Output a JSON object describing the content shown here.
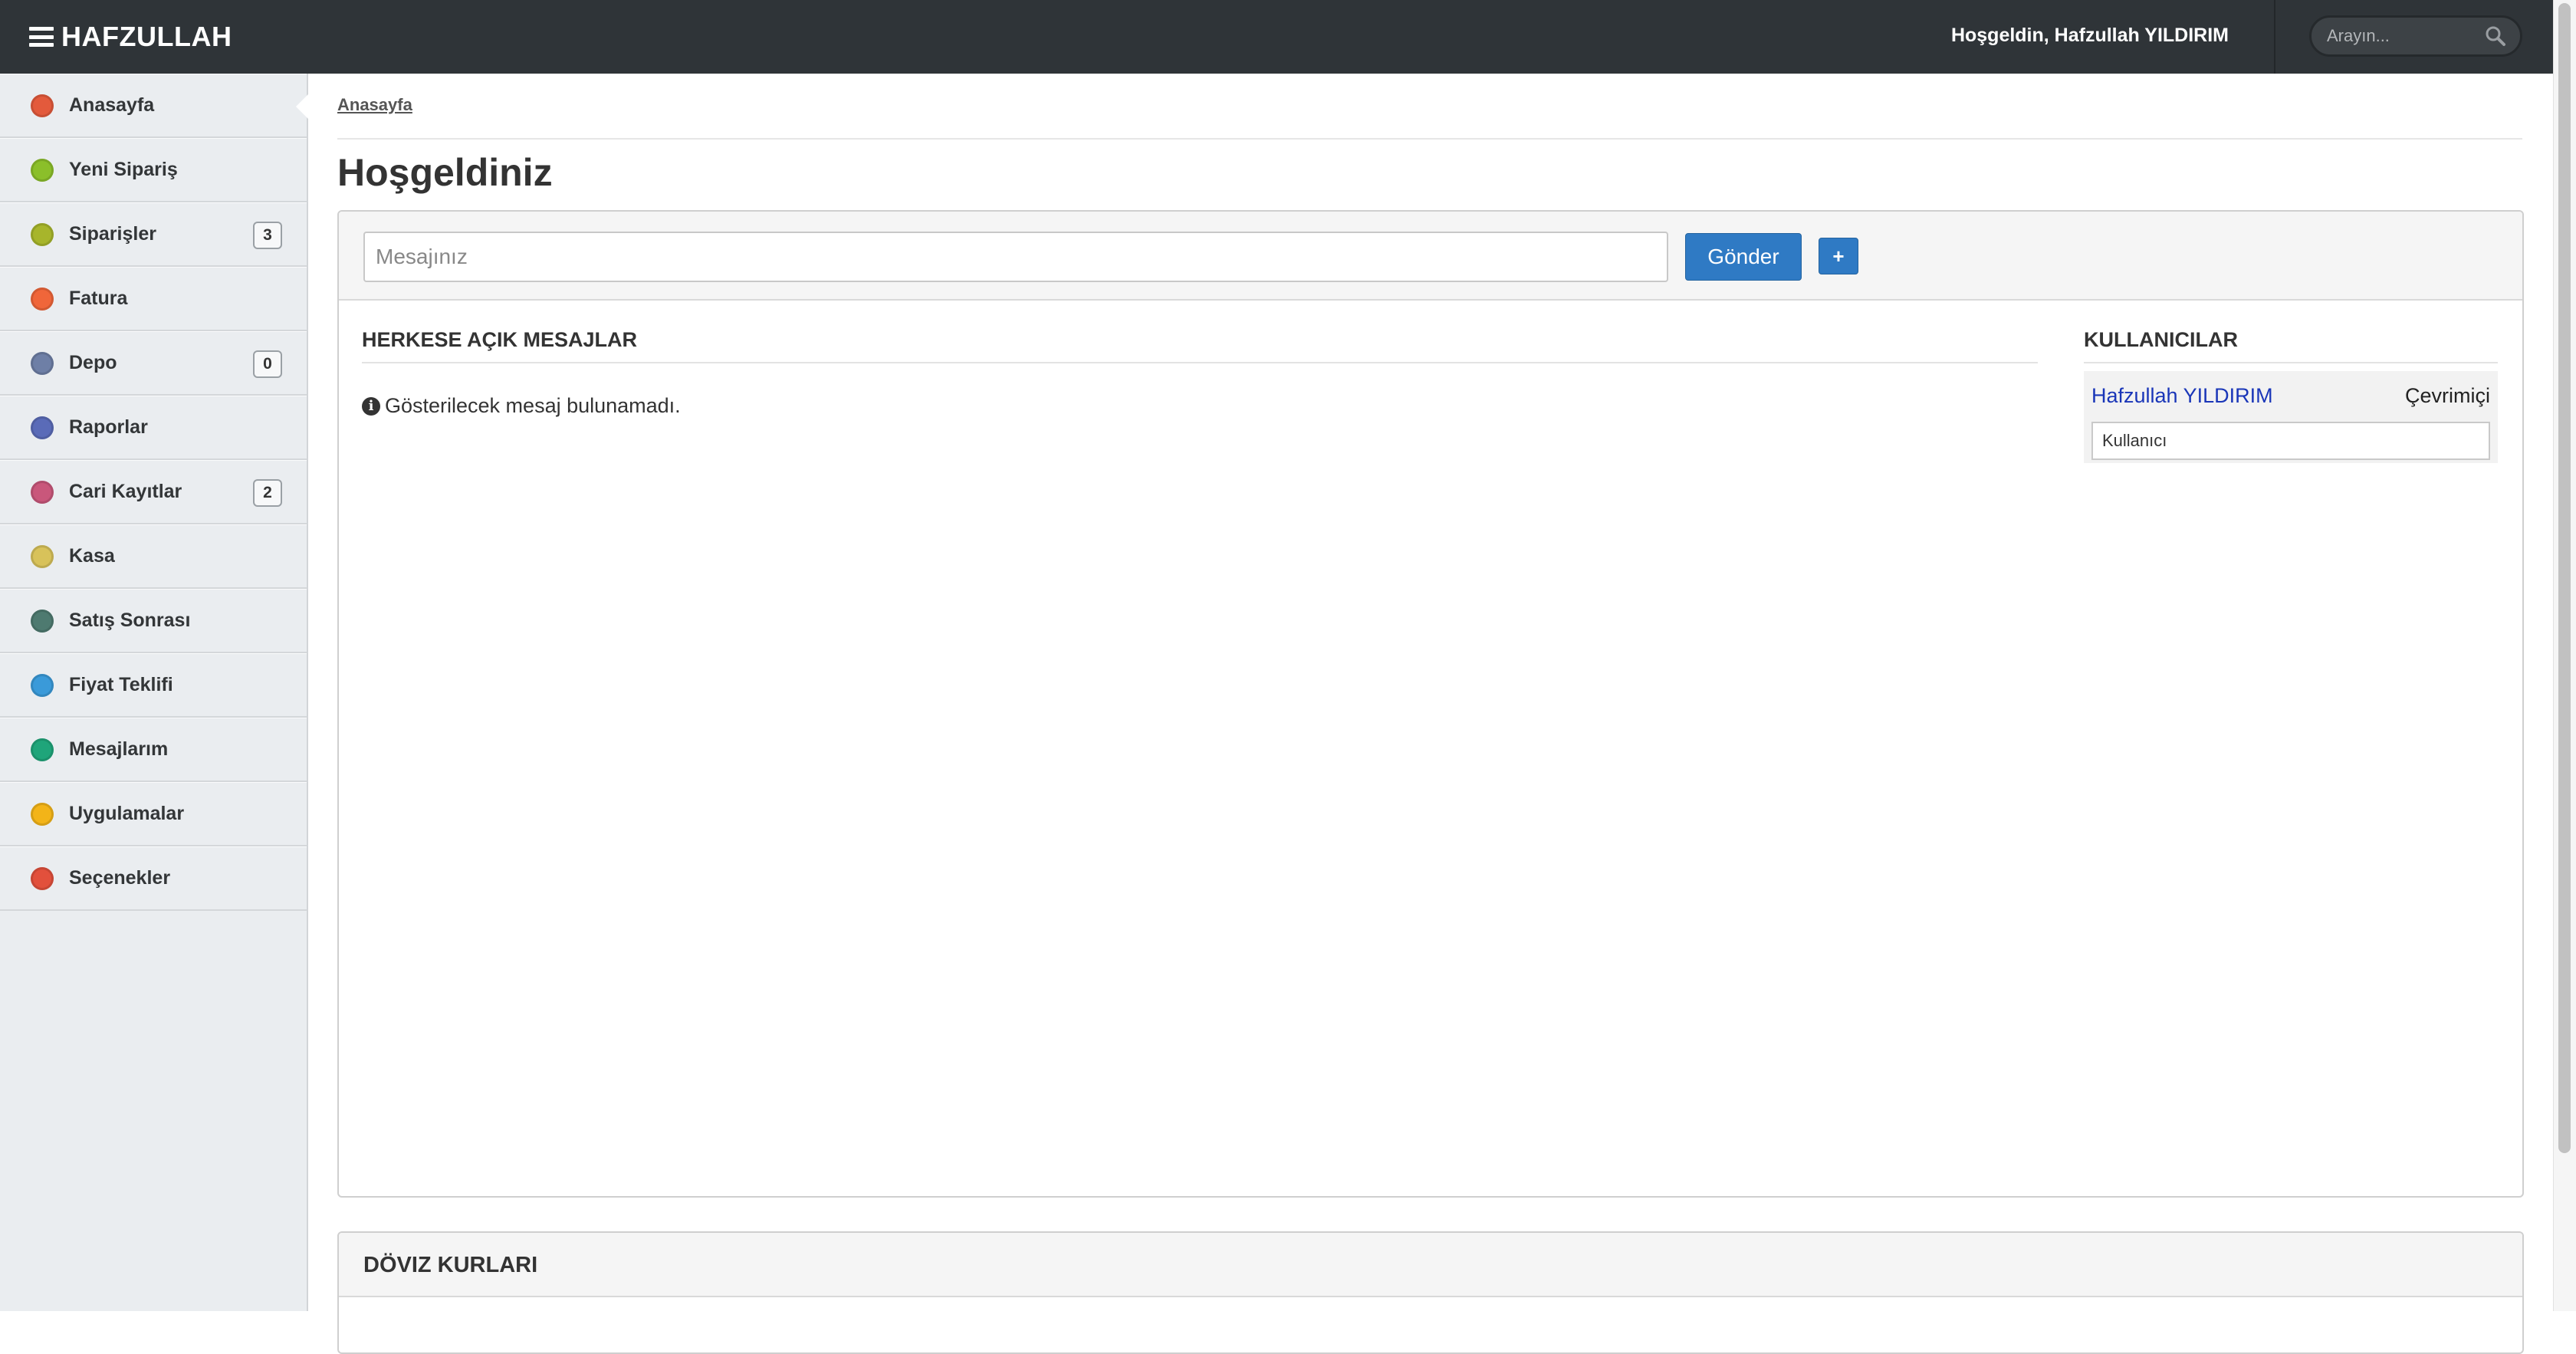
{
  "header": {
    "brand": "HAFZULLAH",
    "welcome": "Hoşgeldin, Hafzullah YILDIRIM",
    "search_placeholder": "Arayın..."
  },
  "sidebar": {
    "items": [
      {
        "label": "Anasayfa",
        "icon": "home-icon",
        "color": "#e35a3c",
        "active": true
      },
      {
        "label": "Yeni Sipariş",
        "icon": "new-order-icon",
        "color": "#8bbf2a"
      },
      {
        "label": "Siparişler",
        "icon": "orders-icon",
        "color": "#a7b52b",
        "badge": "3"
      },
      {
        "label": "Fatura",
        "icon": "invoice-icon",
        "color": "#f0663a"
      },
      {
        "label": "Depo",
        "icon": "warehouse-icon",
        "color": "#6e7fa6",
        "badge": "0"
      },
      {
        "label": "Raporlar",
        "icon": "reports-icon",
        "color": "#5a6bb8"
      },
      {
        "label": "Cari Kayıtlar",
        "icon": "accounts-icon",
        "color": "#c9577b",
        "badge": "2"
      },
      {
        "label": "Kasa",
        "icon": "cashbox-icon",
        "color": "#d8c25a"
      },
      {
        "label": "Satış Sonrası",
        "icon": "after-sales-icon",
        "color": "#4e7a70"
      },
      {
        "label": "Fiyat Teklifi",
        "icon": "price-offer-icon",
        "color": "#3a9ad9"
      },
      {
        "label": "Mesajlarım",
        "icon": "messages-icon",
        "color": "#1fa57a"
      },
      {
        "label": "Uygulamalar",
        "icon": "apps-icon",
        "color": "#f3b418"
      },
      {
        "label": "Seçenekler",
        "icon": "options-icon",
        "color": "#e2503c"
      }
    ]
  },
  "main": {
    "breadcrumb": "Anasayfa",
    "title": "Hoşgeldiniz",
    "message_placeholder": "Mesajınız",
    "send_label": "Gönder",
    "plus_label": "+",
    "public_title": "HERKESE AÇIK MESAJLAR",
    "empty_text": "Gösterilecek mesaj bulunamadı.",
    "users_title": "KULLANICILAR",
    "users": [
      {
        "name": "Hafzullah YILDIRIM",
        "status": "Çevrimiçi"
      }
    ],
    "user_search_placeholder": "Kullanıcı",
    "currency_title": "DÖVIZ KURLARI"
  }
}
